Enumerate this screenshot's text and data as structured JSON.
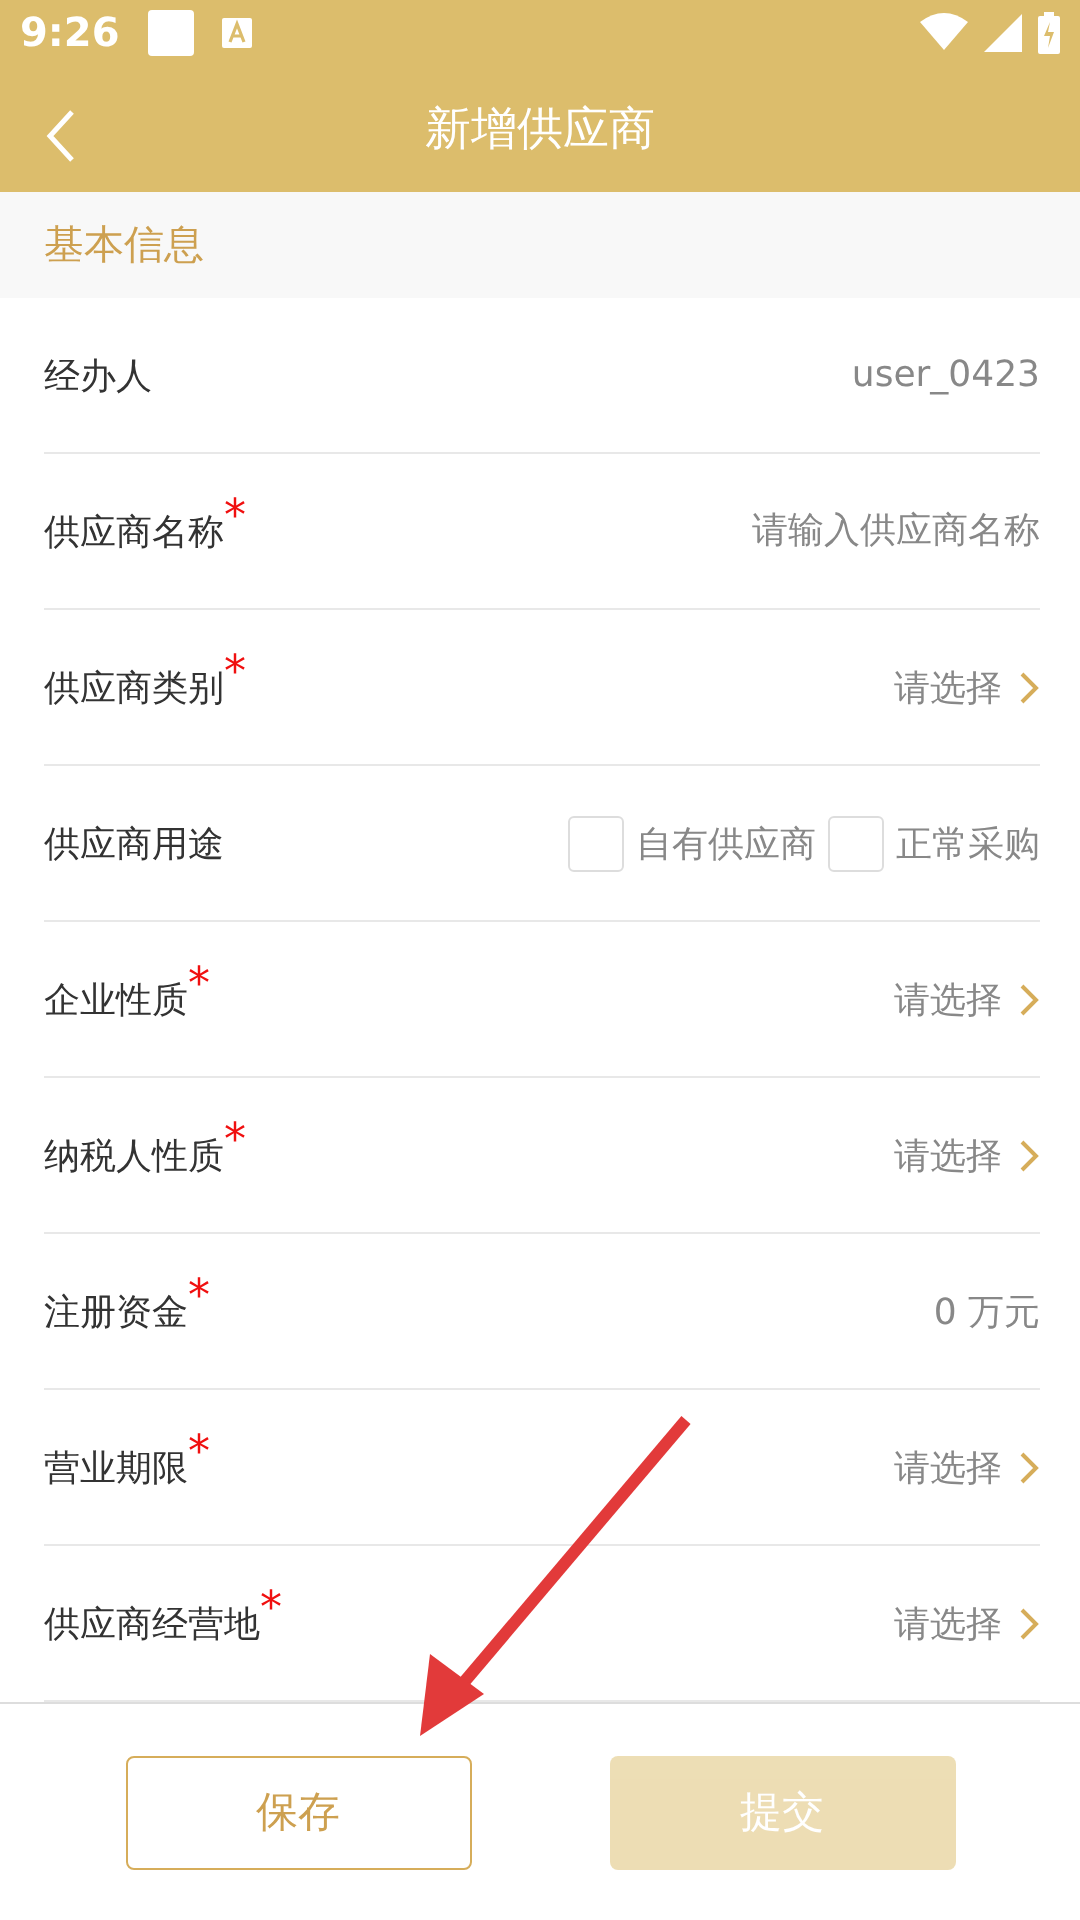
{
  "status_bar": {
    "time": "9:26"
  },
  "header": {
    "title": "新增供应商"
  },
  "section": {
    "title": "基本信息"
  },
  "fields": [
    {
      "kind": "value",
      "label": "经办人",
      "value": "user_0423"
    },
    {
      "kind": "input",
      "label": "供应商名称",
      "mark": "*",
      "placeholder": "请输入供应商名称"
    },
    {
      "kind": "select",
      "label": "供应商类别",
      "mark": "*",
      "value": "请选择"
    },
    {
      "kind": "checks",
      "label": "供应商用途",
      "options": [
        {
          "label": "自有供应商",
          "checked": false
        },
        {
          "label": "正常采购",
          "checked": false
        }
      ]
    },
    {
      "kind": "select",
      "label": "企业性质",
      "mark": "*",
      "value": "请选择"
    },
    {
      "kind": "select",
      "label": "纳税人性质",
      "mark": "*",
      "value": "请选择"
    },
    {
      "kind": "value",
      "label": "注册资金",
      "mark": "*",
      "value": "0 万元"
    },
    {
      "kind": "select",
      "label": "营业期限",
      "mark": "*",
      "value": "请选择"
    },
    {
      "kind": "select",
      "label": "供应商经营地",
      "mark": "*",
      "value": "请选择"
    }
  ],
  "buttons": [
    {
      "label": "保存",
      "kind": "outline",
      "disabled": false
    },
    {
      "label": "提交",
      "kind": "filled",
      "disabled": true
    }
  ]
}
